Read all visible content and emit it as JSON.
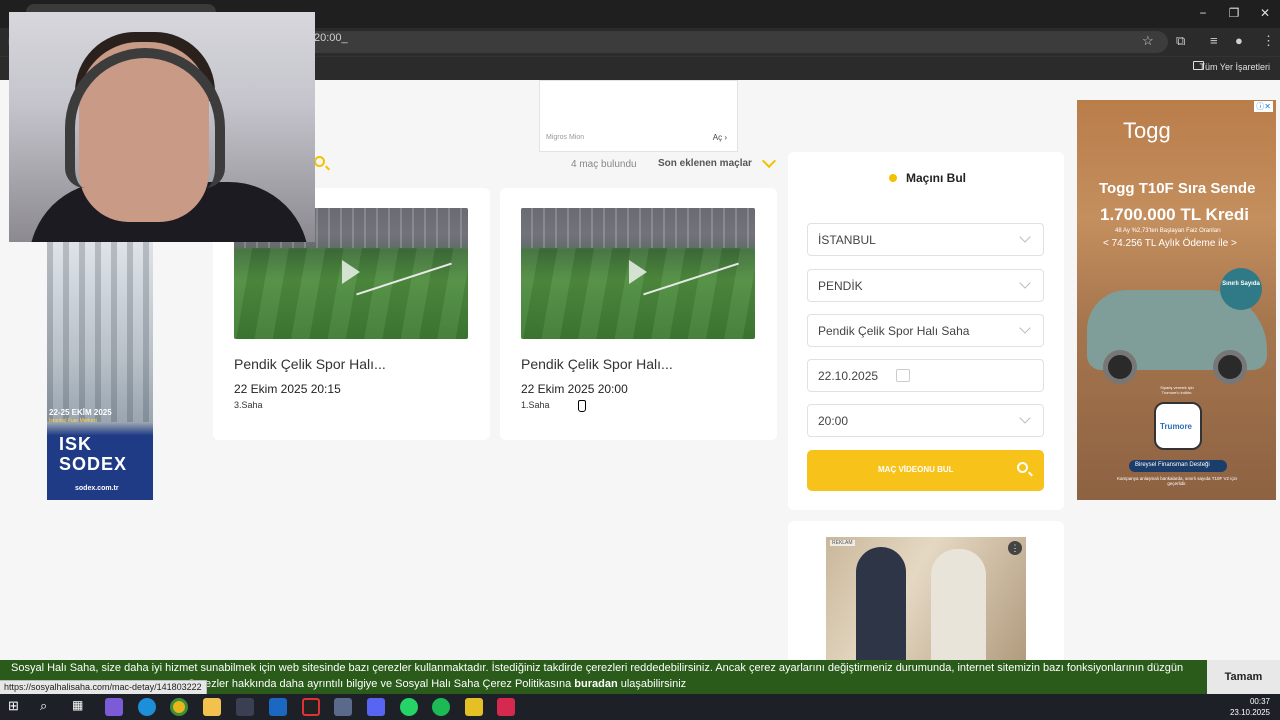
{
  "browser": {
    "url_fragment": "20:00_",
    "bookmarks_all": "Tüm Yer İşaretleri",
    "window_min": "−",
    "window_restore": "❐",
    "window_close": "✕"
  },
  "top_ad": {
    "source": "Migros Mion",
    "open": "Aç ›"
  },
  "results": {
    "count": "4 maç bulundu",
    "sort": "Son eklenen maçlar"
  },
  "matches": [
    {
      "title": "Pendik Çelik Spor Halı...",
      "date": "22 Ekim 2025 20:15",
      "pitch": "3.Saha"
    },
    {
      "title": "Pendik Çelik Spor Halı...",
      "date": "22 Ekim 2025 20:00",
      "pitch": "1.Saha"
    }
  ],
  "finder": {
    "title": "Maçını Bul",
    "city": "İSTANBUL",
    "district": "PENDİK",
    "venue": "Pendik Çelik Spor Halı Saha",
    "date": "22.10.2025",
    "time": "20:00",
    "button": "MAÇ VİDEONU BUL",
    "accent": "#f7c21a"
  },
  "left_ad": {
    "dates": "22-25 EKİM 2025",
    "venue": "İstanbul Fuar Merkezi",
    "logo_line1": "ISK",
    "logo_line2": "SODEX",
    "url": "sodex.com.tr"
  },
  "right_ad": {
    "brand": "Togg",
    "headline": "Togg T10F Sıra Sende",
    "amount": "1.700.000 TL Kredi",
    "terms": "48 Ay %2,73'ten Başlayan Faiz Oranları",
    "monthly": "< 74.256 TL Aylık Ödeme ile >",
    "badge": "Sınırlı Sayıda",
    "order_text": "Sipariş vermek için Trumore'u indirin.",
    "app_name": "Trumore",
    "pill": "Bireysel Finansman Desteği",
    "fine_print": "Kampanya anlaşmalı bankalarda, sınırlı sayıda T10F V2 için geçerlidir."
  },
  "bottom_ad": {
    "badge": "REKLAM",
    "menu": "⋮"
  },
  "cookie": {
    "line1": "Sosyal Halı Saha, size daha iyi hizmet sunabilmek için web sitesinde bazı çerezler kullanmaktadır. İstediğiniz takdirde çerezleri reddedebilirsiniz. Ancak çerez ayarlarını değiştirmeniz durumunda, internet sitemizin bazı fonksiyonlarının düzgün",
    "line2_prefix": "n. Çerezler hakkında daha ayrıntılı bilgiye ve Sosyal Halı Saha Çerez Politikasına ",
    "line2_link": "buradan",
    "line2_suffix": " ulaşabilirsiniz",
    "accept": "Tamam"
  },
  "status_url": "https://sosyalhalisaha.com/mac-detay/141803222",
  "taskbar": {
    "time": "00:37",
    "date": "23.10.2025"
  }
}
